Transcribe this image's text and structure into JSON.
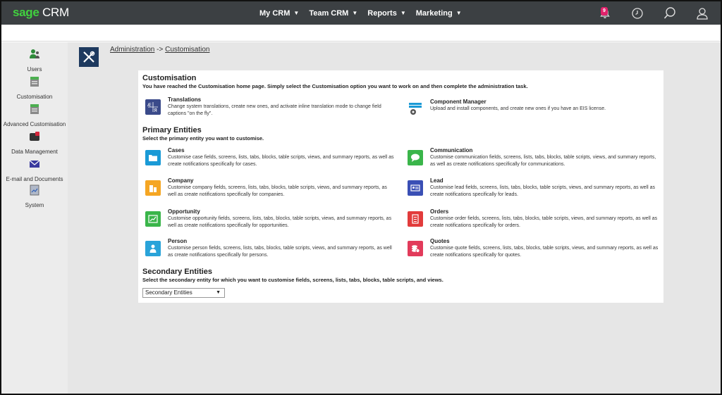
{
  "app": {
    "logo_brand": "sage",
    "logo_product": "CRM"
  },
  "topnav": [
    {
      "label": "My CRM"
    },
    {
      "label": "Team CRM"
    },
    {
      "label": "Reports"
    },
    {
      "label": "Marketing"
    }
  ],
  "topicons": {
    "notification_count": "9",
    "notification_icon": "bell-icon",
    "recent_icon": "clock-icon",
    "search_icon": "search-icon",
    "user_icon": "user-icon"
  },
  "sidebar": {
    "items": [
      {
        "label": "Users",
        "icon": "users-icon"
      },
      {
        "label": "Customisation",
        "icon": "customisation-icon"
      },
      {
        "label": "Advanced Customisation",
        "icon": "advanced-customisation-icon"
      },
      {
        "label": "Data Management",
        "icon": "data-management-icon"
      },
      {
        "label": "E-mail and Documents",
        "icon": "email-icon"
      },
      {
        "label": "System",
        "icon": "system-icon"
      }
    ]
  },
  "breadcrumb": {
    "root": "Administration",
    "separator": "->",
    "current": "Customisation"
  },
  "customisation": {
    "title": "Customisation",
    "intro": "You have reached the Customisation home page. Simply select the Customisation option you want to work on and then complete the administration task.",
    "translations": {
      "title": "Translations",
      "desc": "Change system translations, create new ones, and activate inline translation mode to change field captions \"on the fly\"."
    },
    "component_manager": {
      "title": "Component Manager",
      "desc": "Upload and install components, and create new ones if you have an EIS license."
    }
  },
  "primary": {
    "title": "Primary Entities",
    "sub": "Select the primary entity you want to customise.",
    "entities": [
      {
        "title": "Cases",
        "desc": "Customise case fields, screens, lists, tabs, blocks, table scripts, views, and summary reports, as well as create notifications specifically for cases.",
        "color": "#1a9ad6",
        "icon": "folder-icon"
      },
      {
        "title": "Communication",
        "desc": "Customise communication fields, screens, lists, tabs, blocks, table scripts, views, and summary reports, as well as create notifications specifically for communications.",
        "color": "#3ab54a",
        "icon": "speech-bubble-icon"
      },
      {
        "title": "Company",
        "desc": "Customise company fields, screens, lists, tabs, blocks, table scripts, views, and summary reports, as well as create notifications specifically for companies.",
        "color": "#f5a623",
        "icon": "building-icon"
      },
      {
        "title": "Lead",
        "desc": "Customise lead fields, screens, lists, tabs, blocks, table scripts, views, and summary reports, as well as create notifications specifically for leads.",
        "color": "#3a4fb5",
        "icon": "id-card-icon"
      },
      {
        "title": "Opportunity",
        "desc": "Customise opportunity fields, screens, lists, tabs, blocks, table scripts, views, and summary reports, as well as create notifications specifically for opportunities.",
        "color": "#3ab54a",
        "icon": "chart-icon"
      },
      {
        "title": "Orders",
        "desc": "Customise order fields, screens, lists, tabs, blocks, table scripts, views, and summary reports, as well as create notifications specifically for orders.",
        "color": "#e23b3b",
        "icon": "document-icon"
      },
      {
        "title": "Person",
        "desc": "Customise person fields, screens, lists, tabs, blocks, table scripts, views, and summary reports, as well as create notifications specifically for persons.",
        "color": "#29a3d9",
        "icon": "person-icon"
      },
      {
        "title": "Quotes",
        "desc": "Customise quote fields, screens, lists, tabs, blocks, table scripts, views, and summary reports, as well as create notifications specifically for quotes.",
        "color": "#e23b5b",
        "icon": "coins-icon"
      }
    ]
  },
  "secondary": {
    "title": "Secondary Entities",
    "sub": "Select the secondary entity for which you want to customise fields, screens, lists, tabs, blocks, table scripts, and views.",
    "select_value": "Secondary Entities"
  }
}
